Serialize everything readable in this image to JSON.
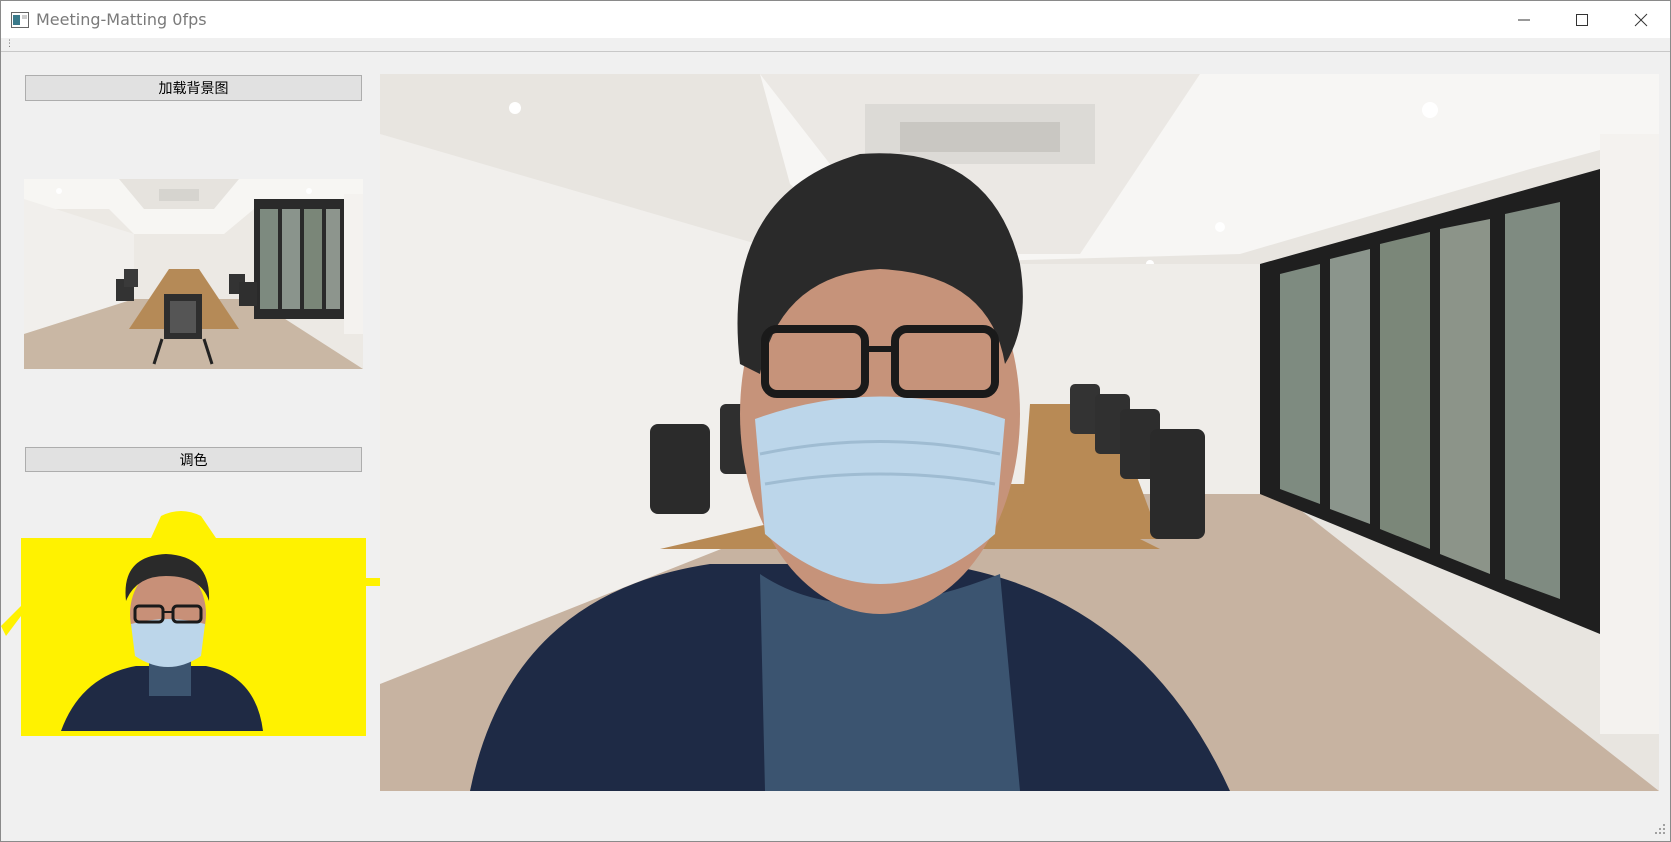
{
  "window": {
    "title": "Meeting-Matting 0fps"
  },
  "titlebar_controls": {
    "minimize": "minimize-icon",
    "maximize": "maximize-icon",
    "close": "close-icon"
  },
  "left_panel": {
    "load_background_button": "加载背景图",
    "color_adjust_button": "调色"
  },
  "colors": {
    "matte_fill": "#fff200",
    "titlebar_bg": "#ffffff",
    "window_bg": "#f0f0f0",
    "button_bg": "#e1e1e1"
  }
}
